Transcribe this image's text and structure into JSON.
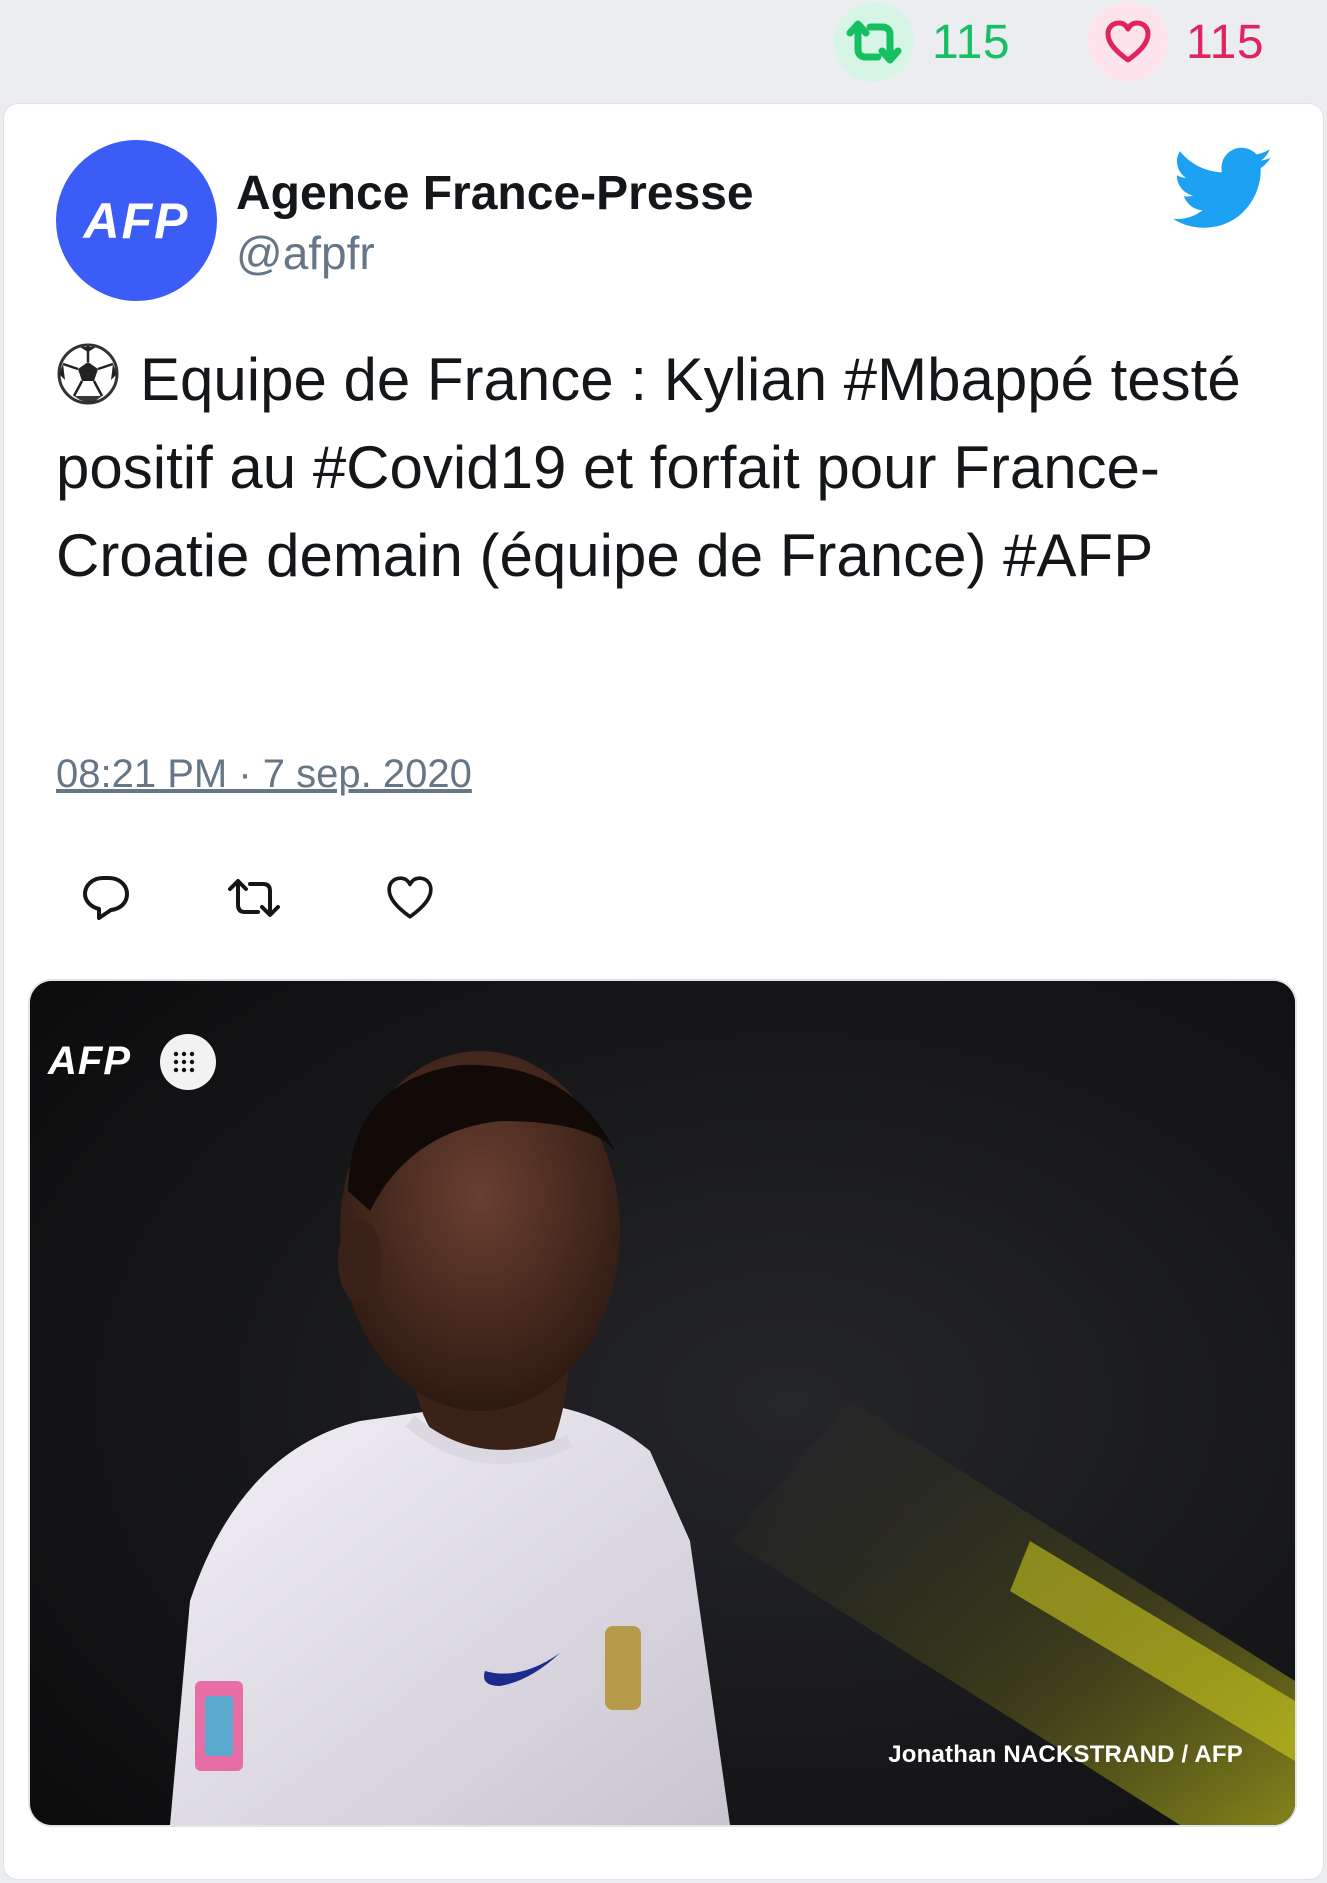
{
  "stats": {
    "retweet_count": "115",
    "like_count": "115",
    "retweet_color": "#17bf63",
    "like_color": "#e0245e",
    "retweet_icon": "retweet-icon",
    "like_icon": "heart-icon"
  },
  "tweet": {
    "avatar_text": "AFP",
    "avatar_color": "#3b5cf6",
    "author_name": "Agence France-Presse",
    "author_handle": "@afpfr",
    "brand_icon": "twitter-bird-icon",
    "brand_color": "#1da1f2",
    "emoji": "soccer-ball-icon",
    "text": "Equipe de France : Kylian #Mbappé testé positif au #Covid19 et forfait pour France-Croatie demain (équipe de France) #AFP",
    "timestamp": "08:21 PM · 7 sep. 2020"
  },
  "actions": [
    {
      "name": "reply",
      "icon": "reply-icon"
    },
    {
      "name": "retweet",
      "icon": "retweet-icon"
    },
    {
      "name": "like",
      "icon": "heart-icon"
    }
  ],
  "media": {
    "logo_text": "AFP",
    "photo_credit": "Jonathan NACKSTRAND / AFP"
  }
}
